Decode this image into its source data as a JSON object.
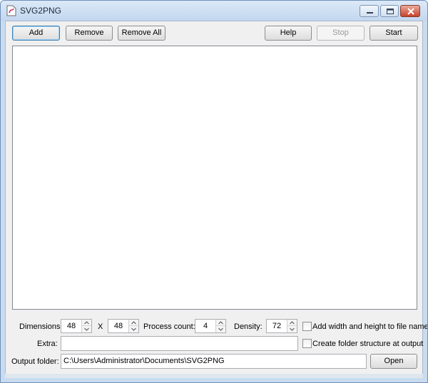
{
  "window": {
    "title": "SVG2PNG",
    "icon": "svg-file-icon"
  },
  "toolbar": {
    "add": "Add",
    "remove": "Remove",
    "remove_all": "Remove All",
    "help": "Help",
    "stop": "Stop",
    "start": "Start"
  },
  "file_list": {
    "items": []
  },
  "options": {
    "dimensions_label": "Dimensions:",
    "width": "48",
    "x_label": "X",
    "height": "48",
    "process_count_label": "Process count:",
    "process_count": "4",
    "density_label": "Density:",
    "density": "72",
    "add_wh_label": "Add width and height to file name",
    "add_wh_checked": false,
    "extra_label": "Extra:",
    "extra_value": "",
    "folder_structure_label": "Create folder structure at output",
    "folder_structure_checked": false,
    "output_folder_label": "Output folder:",
    "output_folder": "C:\\Users\\Administrator\\Documents\\SVG2PNG",
    "open": "Open"
  },
  "colors": {
    "title_bar": "#c9dbef",
    "default_button_border": "#3c7fb1",
    "close_button": "#c8412a"
  }
}
